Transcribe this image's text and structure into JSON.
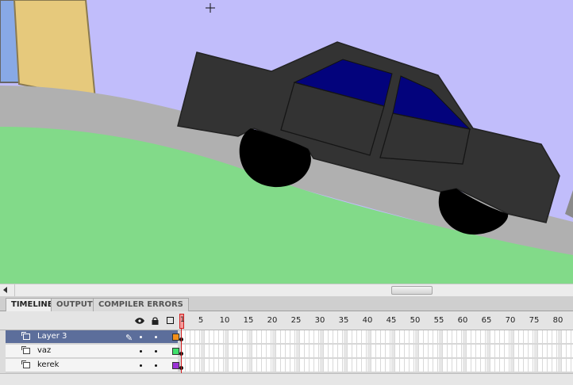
{
  "tabs": [
    {
      "label": "TIMELINE",
      "active": true
    },
    {
      "label": "OUTPUT",
      "active": false
    },
    {
      "label": "COMPILER ERRORS",
      "active": false
    }
  ],
  "timeline": {
    "header_icons": [
      "eye-icon",
      "lock-icon",
      "outline-icon"
    ],
    "playhead_frame": "1",
    "frame_numbers": [
      "5",
      "10",
      "15",
      "20",
      "25",
      "30",
      "35",
      "40",
      "45",
      "50",
      "55",
      "60",
      "65",
      "70",
      "75",
      "80"
    ],
    "layers": [
      {
        "name": "Layer 3",
        "selected": true,
        "color": "#f39019"
      },
      {
        "name": "vaz",
        "selected": false,
        "color": "#3ee06a"
      },
      {
        "name": "kerek",
        "selected": false,
        "color": "#9b33d6"
      }
    ]
  },
  "stage": {
    "colors": {
      "sky": "#c1bdfb",
      "building": "#e6c97c",
      "road": "#b0b0b0",
      "grass": "#82da89",
      "car_body": "#333333",
      "car_window": "#03037c",
      "wheel": "#000000"
    }
  }
}
